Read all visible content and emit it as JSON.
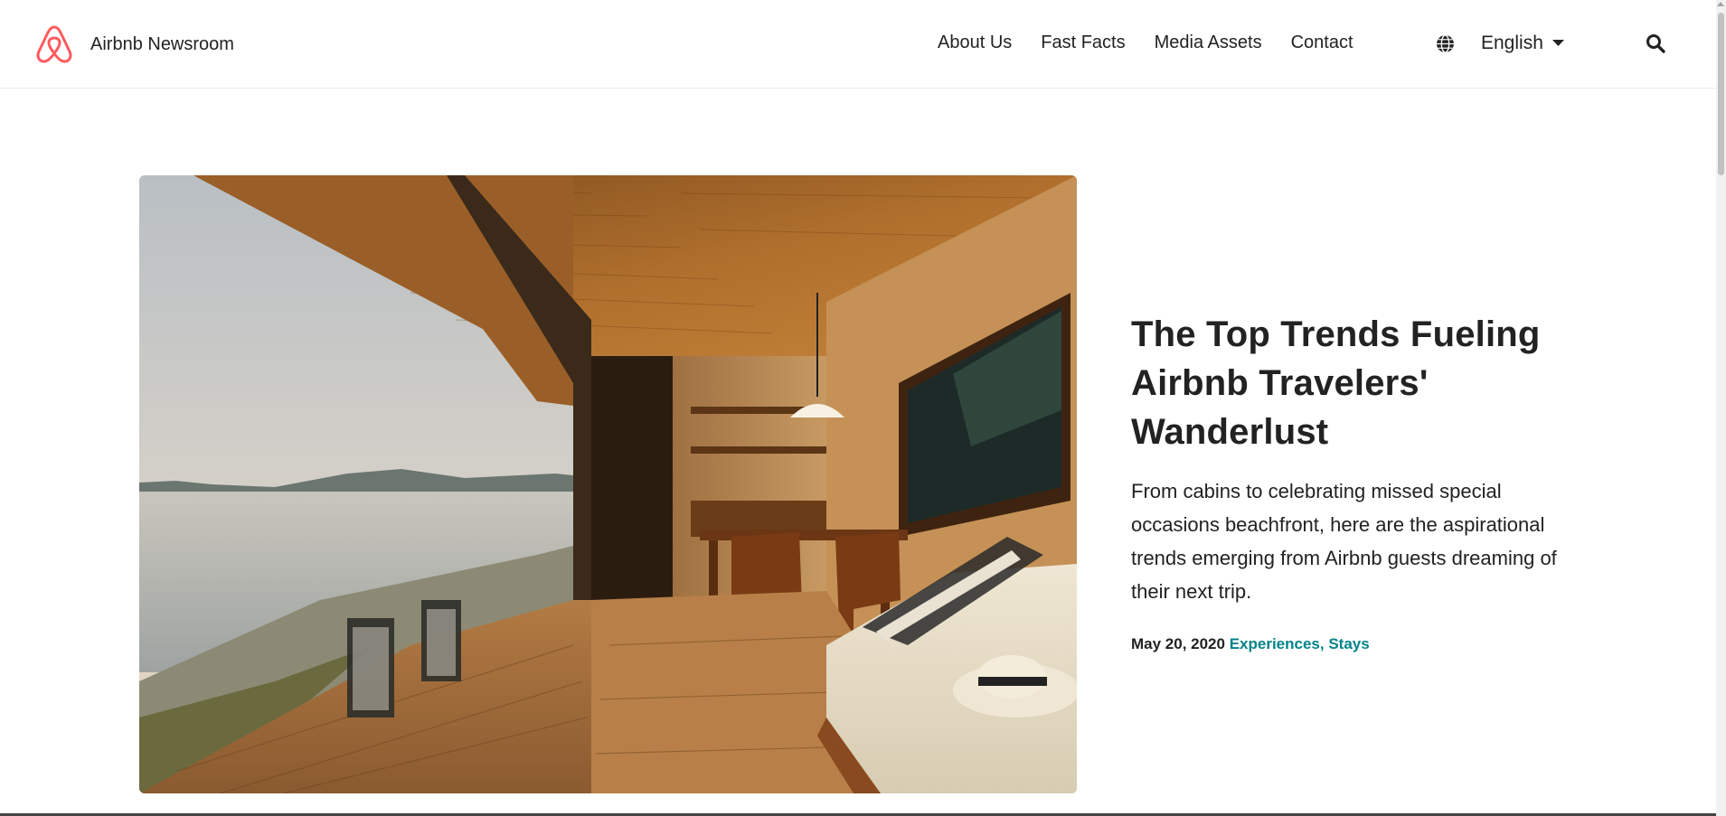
{
  "header": {
    "brand_name": "Airbnb Newsroom",
    "nav": [
      "About Us",
      "Fast Facts",
      "Media Assets",
      "Contact"
    ],
    "language": "English"
  },
  "article": {
    "title": "The Top Trends Fueling Airbnb Travelers' Wanderlust",
    "summary": "From cabins to celebrating missed special occasions beachfront, here are the aspirational trends emerging from Airbnb guests dreaming of their next trip.",
    "date": "May 20, 2020",
    "tags": [
      "Experiences",
      "Stays"
    ]
  },
  "colors": {
    "brand": "#ff5a5f",
    "tag": "#008489",
    "text": "#222222"
  },
  "icons": {
    "logo": "airbnb-belo-icon",
    "language": "globe-icon",
    "dropdown": "caret-down-icon",
    "search": "search-icon"
  }
}
